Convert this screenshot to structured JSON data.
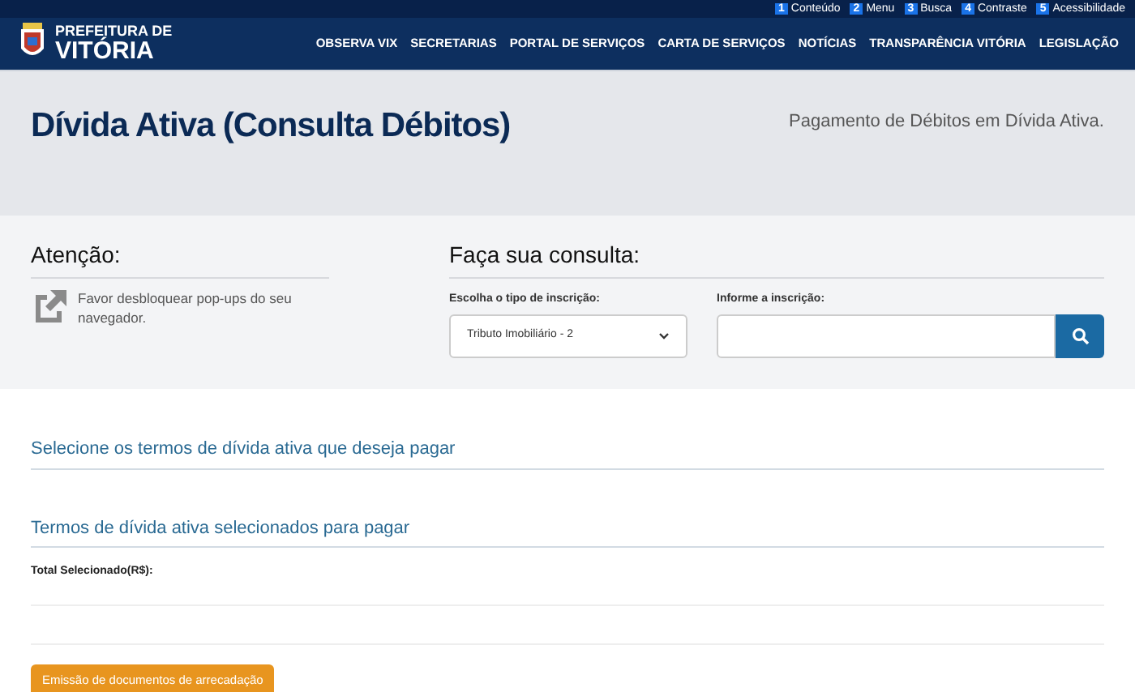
{
  "accessibility_links": [
    {
      "key": "1",
      "label": "Conteúdo"
    },
    {
      "key": "2",
      "label": "Menu"
    },
    {
      "key": "3",
      "label": "Busca"
    },
    {
      "key": "4",
      "label": "Contraste"
    },
    {
      "key": "5",
      "label": "Acessibilidade"
    }
  ],
  "logo": {
    "line_1": "PREFEITURA DE",
    "line_2": "VITÓRIA"
  },
  "nav": [
    "OBSERVA VIX",
    "SECRETARIAS",
    "PORTAL DE SERVIÇOS",
    "CARTA DE SERVIÇOS",
    "NOTÍCIAS",
    "TRANSPARÊNCIA VITÓRIA",
    "LEGISLAÇÃO"
  ],
  "hero": {
    "title": "Dívida Ativa (Consulta Débitos)",
    "subtitle": "Pagamento de Débitos em Dívida Ativa."
  },
  "attention": {
    "title": "Atenção:",
    "message": "Favor desbloquear pop-ups do seu navegador."
  },
  "query": {
    "title": "Faça sua consulta:",
    "type_label": "Escolha o tipo de inscrição:",
    "type_value": "Tributo Imobiliário - 2",
    "number_label": "Informe a inscrição:"
  },
  "sections": [
    "Selecione os termos de dívida ativa que deseja pagar",
    "Termos de dívida ativa selecionados para pagar"
  ],
  "total_label": "Total Selecionado(R$):",
  "emit_button": "Emissão de documentos de arrecadação"
}
